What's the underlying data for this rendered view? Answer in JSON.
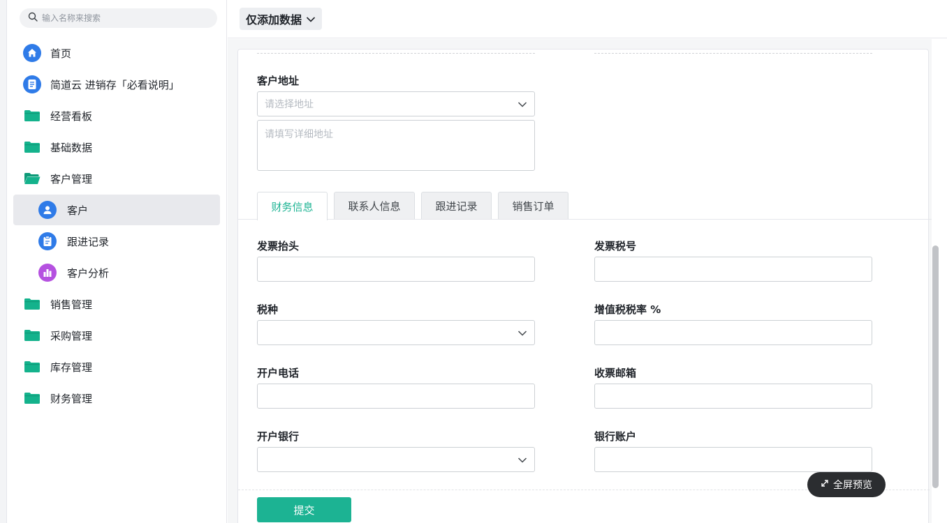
{
  "search": {
    "placeholder": "输入名称来搜索"
  },
  "sidebar": {
    "items": [
      {
        "label": "首页",
        "icon": "home-icon"
      },
      {
        "label": "简道云 进销存「必看说明」",
        "icon": "document-icon"
      },
      {
        "label": "经营看板",
        "icon": "folder-icon"
      },
      {
        "label": "基础数据",
        "icon": "folder-icon"
      },
      {
        "label": "客户管理",
        "icon": "folder-open-icon"
      },
      {
        "label": "客户",
        "icon": "user-icon",
        "active": true
      },
      {
        "label": "跟进记录",
        "icon": "clipboard-icon"
      },
      {
        "label": "客户分析",
        "icon": "bar-chart-icon"
      },
      {
        "label": "销售管理",
        "icon": "folder-icon"
      },
      {
        "label": "采购管理",
        "icon": "folder-icon"
      },
      {
        "label": "库存管理",
        "icon": "folder-icon"
      },
      {
        "label": "财务管理",
        "icon": "folder-icon"
      }
    ]
  },
  "header": {
    "view_label": "仅添加数据"
  },
  "form": {
    "address": {
      "label": "客户地址",
      "select_placeholder": "请选择地址",
      "detail_placeholder": "请填写详细地址"
    },
    "tabs": [
      {
        "label": "财务信息",
        "active": true
      },
      {
        "label": "联系人信息"
      },
      {
        "label": "跟进记录"
      },
      {
        "label": "销售订单"
      }
    ],
    "fields": {
      "invoice_title": "发票抬头",
      "tax_number": "发票税号",
      "tax_type": "税种",
      "vat_rate": "增值税税率 %",
      "phone": "开户电话",
      "email": "收票邮箱",
      "bank": "开户银行",
      "account": "银行账户"
    },
    "submit_label": "提交"
  },
  "fullscreen_label": "全屏预览",
  "colors": {
    "accent": "#1cb393",
    "folder": "#14b28c",
    "blue_icon": "#2f7be8",
    "purple_icon": "#b551e0"
  }
}
